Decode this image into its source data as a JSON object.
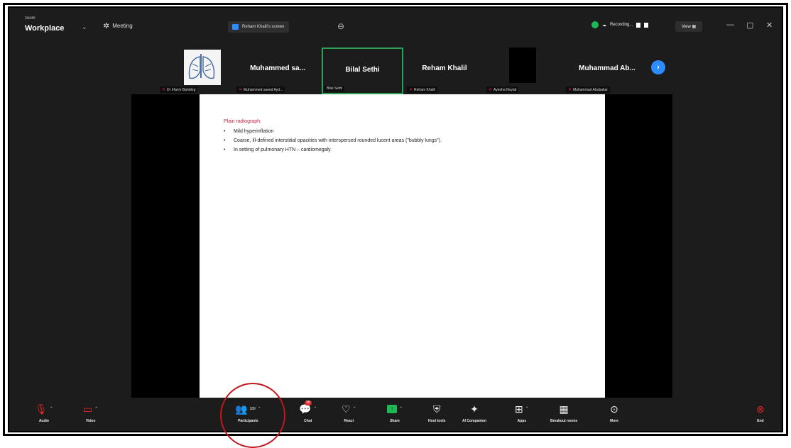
{
  "window": {
    "brand_small": "zoom",
    "brand_big": "Workplace",
    "meeting_label": "Meeting",
    "screen_tab_label": "Reham Khalil's screen",
    "recording_label": "Recording...",
    "view_label": "View"
  },
  "participants": [
    {
      "name": "",
      "label": "Dr Irfan'e Bahrikrg",
      "image": "lungs-xray"
    },
    {
      "name": "Muhammed sa...",
      "label": "Muhammed saeed Ayd..."
    },
    {
      "name": "Bilal Sethi",
      "label": "Bilal Sethi",
      "active": true
    },
    {
      "name": "Reham Khalil",
      "label": "Reham Khalil"
    },
    {
      "name": "",
      "label": "Ayesha Noyab"
    },
    {
      "name": "Muhammad Ab...",
      "label": "Muhammad Abubakar"
    }
  ],
  "slide": {
    "heading": "Plain radiograph:",
    "bullets": [
      "Mild hyperinflation",
      "Coarse, ill-defined interstitial opacities with interspersed rounded lucent areas (\"bubbly lungs\").",
      "In setting of pulmonary HTN – cardiomegaly."
    ]
  },
  "toolbar": {
    "audio": "Audio",
    "video": "Video",
    "participants": "Participants",
    "participants_count": "189",
    "chat": "Chat",
    "chat_badge": "38",
    "react": "React",
    "share": "Share",
    "host_tools": "Host tools",
    "ai_companion": "AI Companion",
    "apps": "Apps",
    "breakout_rooms": "Breakout rooms",
    "more": "More",
    "end": "End"
  },
  "colors": {
    "background": "#1c1c1c",
    "accent_blue": "#2d8cff",
    "active_speaker": "#2ea05a",
    "recording_green": "#1db954",
    "heading_red": "#c0203a",
    "annotation_red": "#c0181e"
  }
}
